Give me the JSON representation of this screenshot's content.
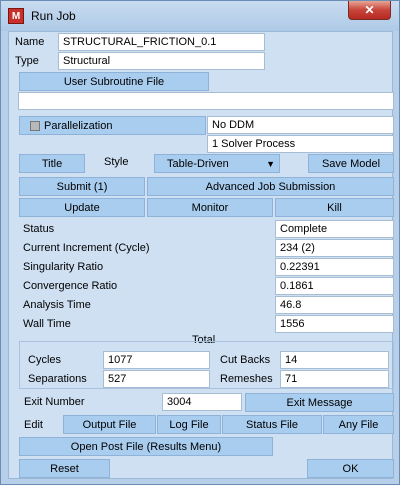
{
  "window": {
    "title": "Run Job",
    "app_icon_letter": "M",
    "close_glyph": "✕"
  },
  "job": {
    "name_label": "Name",
    "name_value": "STRUCTURAL_FRICTION_0.1",
    "type_label": "Type",
    "type_value": "Structural",
    "user_subroutine_button": "User Subroutine File",
    "user_subroutine_value": ""
  },
  "parallel": {
    "button": "Parallelization",
    "ddm_value": "No DDM",
    "solver_value": "1 Solver Process"
  },
  "style_row": {
    "title_button": "Title",
    "style_label": "Style",
    "style_select": "Table-Driven",
    "save_model_button": "Save Model"
  },
  "actions": {
    "submit": "Submit (1)",
    "advanced": "Advanced Job Submission",
    "update": "Update",
    "monitor": "Monitor",
    "kill": "Kill"
  },
  "status": [
    {
      "label": "Status",
      "value": "Complete"
    },
    {
      "label": "Current Increment (Cycle)",
      "value": "234 (2)"
    },
    {
      "label": "Singularity Ratio",
      "value": "0.22391"
    },
    {
      "label": "Convergence Ratio",
      "value": "0.1861"
    },
    {
      "label": "Analysis Time",
      "value": "46.8"
    },
    {
      "label": "Wall Time",
      "value": "1556"
    }
  ],
  "total": {
    "title": "Total",
    "cycles_label": "Cycles",
    "cycles_value": "1077",
    "separations_label": "Separations",
    "separations_value": "527",
    "cutbacks_label": "Cut Backs",
    "cutbacks_value": "14",
    "remeshes_label": "Remeshes",
    "remeshes_value": "71"
  },
  "exit": {
    "number_label": "Exit Number",
    "number_value": "3004",
    "message_button": "Exit Message"
  },
  "edit": {
    "label": "Edit",
    "output_file": "Output File",
    "log_file": "Log File",
    "status_file": "Status File",
    "any_file": "Any File"
  },
  "open_post_button": "Open Post File (Results Menu)",
  "reset_button": "Reset",
  "ok_button": "OK",
  "colors": {
    "button": "#a9cdef",
    "panel": "#cfe0f3",
    "frame": "#b7cfe8",
    "close": "#c7443a"
  }
}
